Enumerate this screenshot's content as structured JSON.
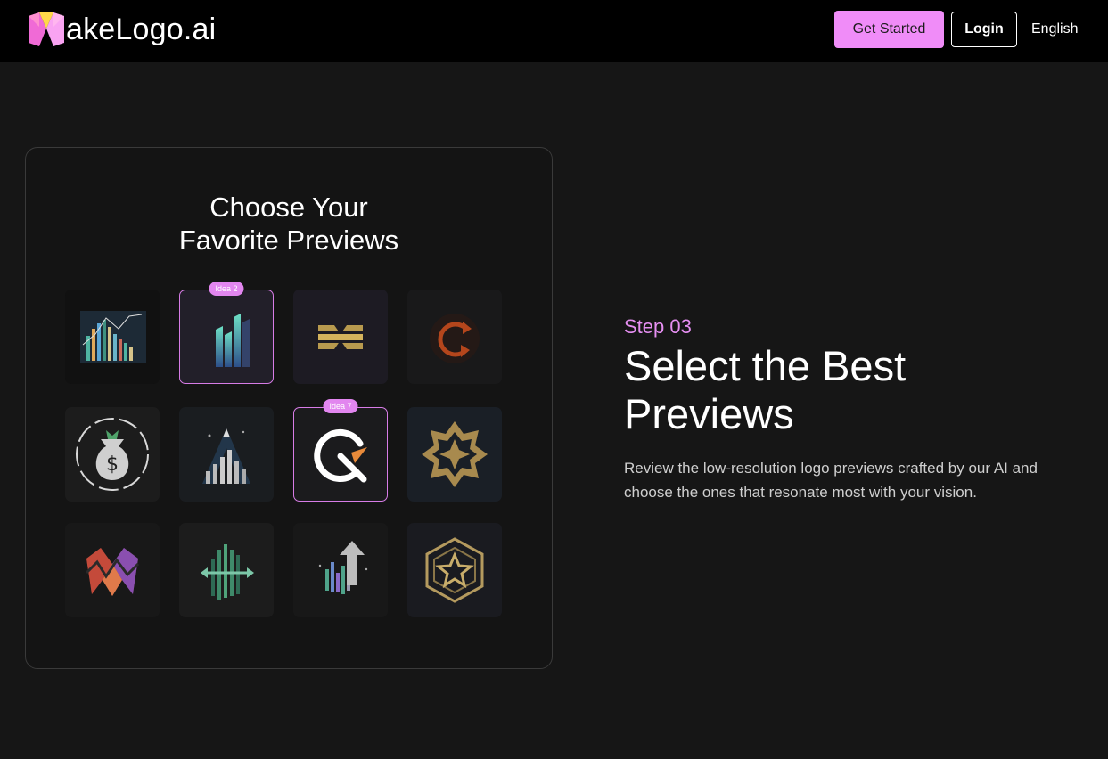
{
  "brand": {
    "name": "akeLogo.ai",
    "logo_icon": "m-logo-icon",
    "accent": "#f08cf8"
  },
  "nav": {
    "get_started": "Get Started",
    "login": "Login",
    "language": "English"
  },
  "card": {
    "title_line1": "Choose Your",
    "title_line2": "Favorite Previews",
    "tiles": [
      {
        "icon": "city-skyline-chart-icon"
      },
      {
        "icon": "bar-chart-icon",
        "badge": "Idea 2",
        "selected": true
      },
      {
        "icon": "stacked-bars-icon"
      },
      {
        "icon": "circular-arrow-c-icon"
      },
      {
        "icon": "money-bag-icon"
      },
      {
        "icon": "triangle-bars-icon"
      },
      {
        "icon": "q-arrow-icon",
        "badge": "Idea 7",
        "selected": true
      },
      {
        "icon": "octagram-star-icon"
      },
      {
        "icon": "w-mountain-icon"
      },
      {
        "icon": "arrows-bars-icon"
      },
      {
        "icon": "growth-arrow-icon"
      },
      {
        "icon": "hexagon-star-icon"
      }
    ]
  },
  "step": {
    "label": "Step 03",
    "title_line1": "Select the Best",
    "title_line2": "Previews",
    "description": "Review the low-resolution logo previews crafted by our AI and choose the ones that resonate most with your vision."
  }
}
